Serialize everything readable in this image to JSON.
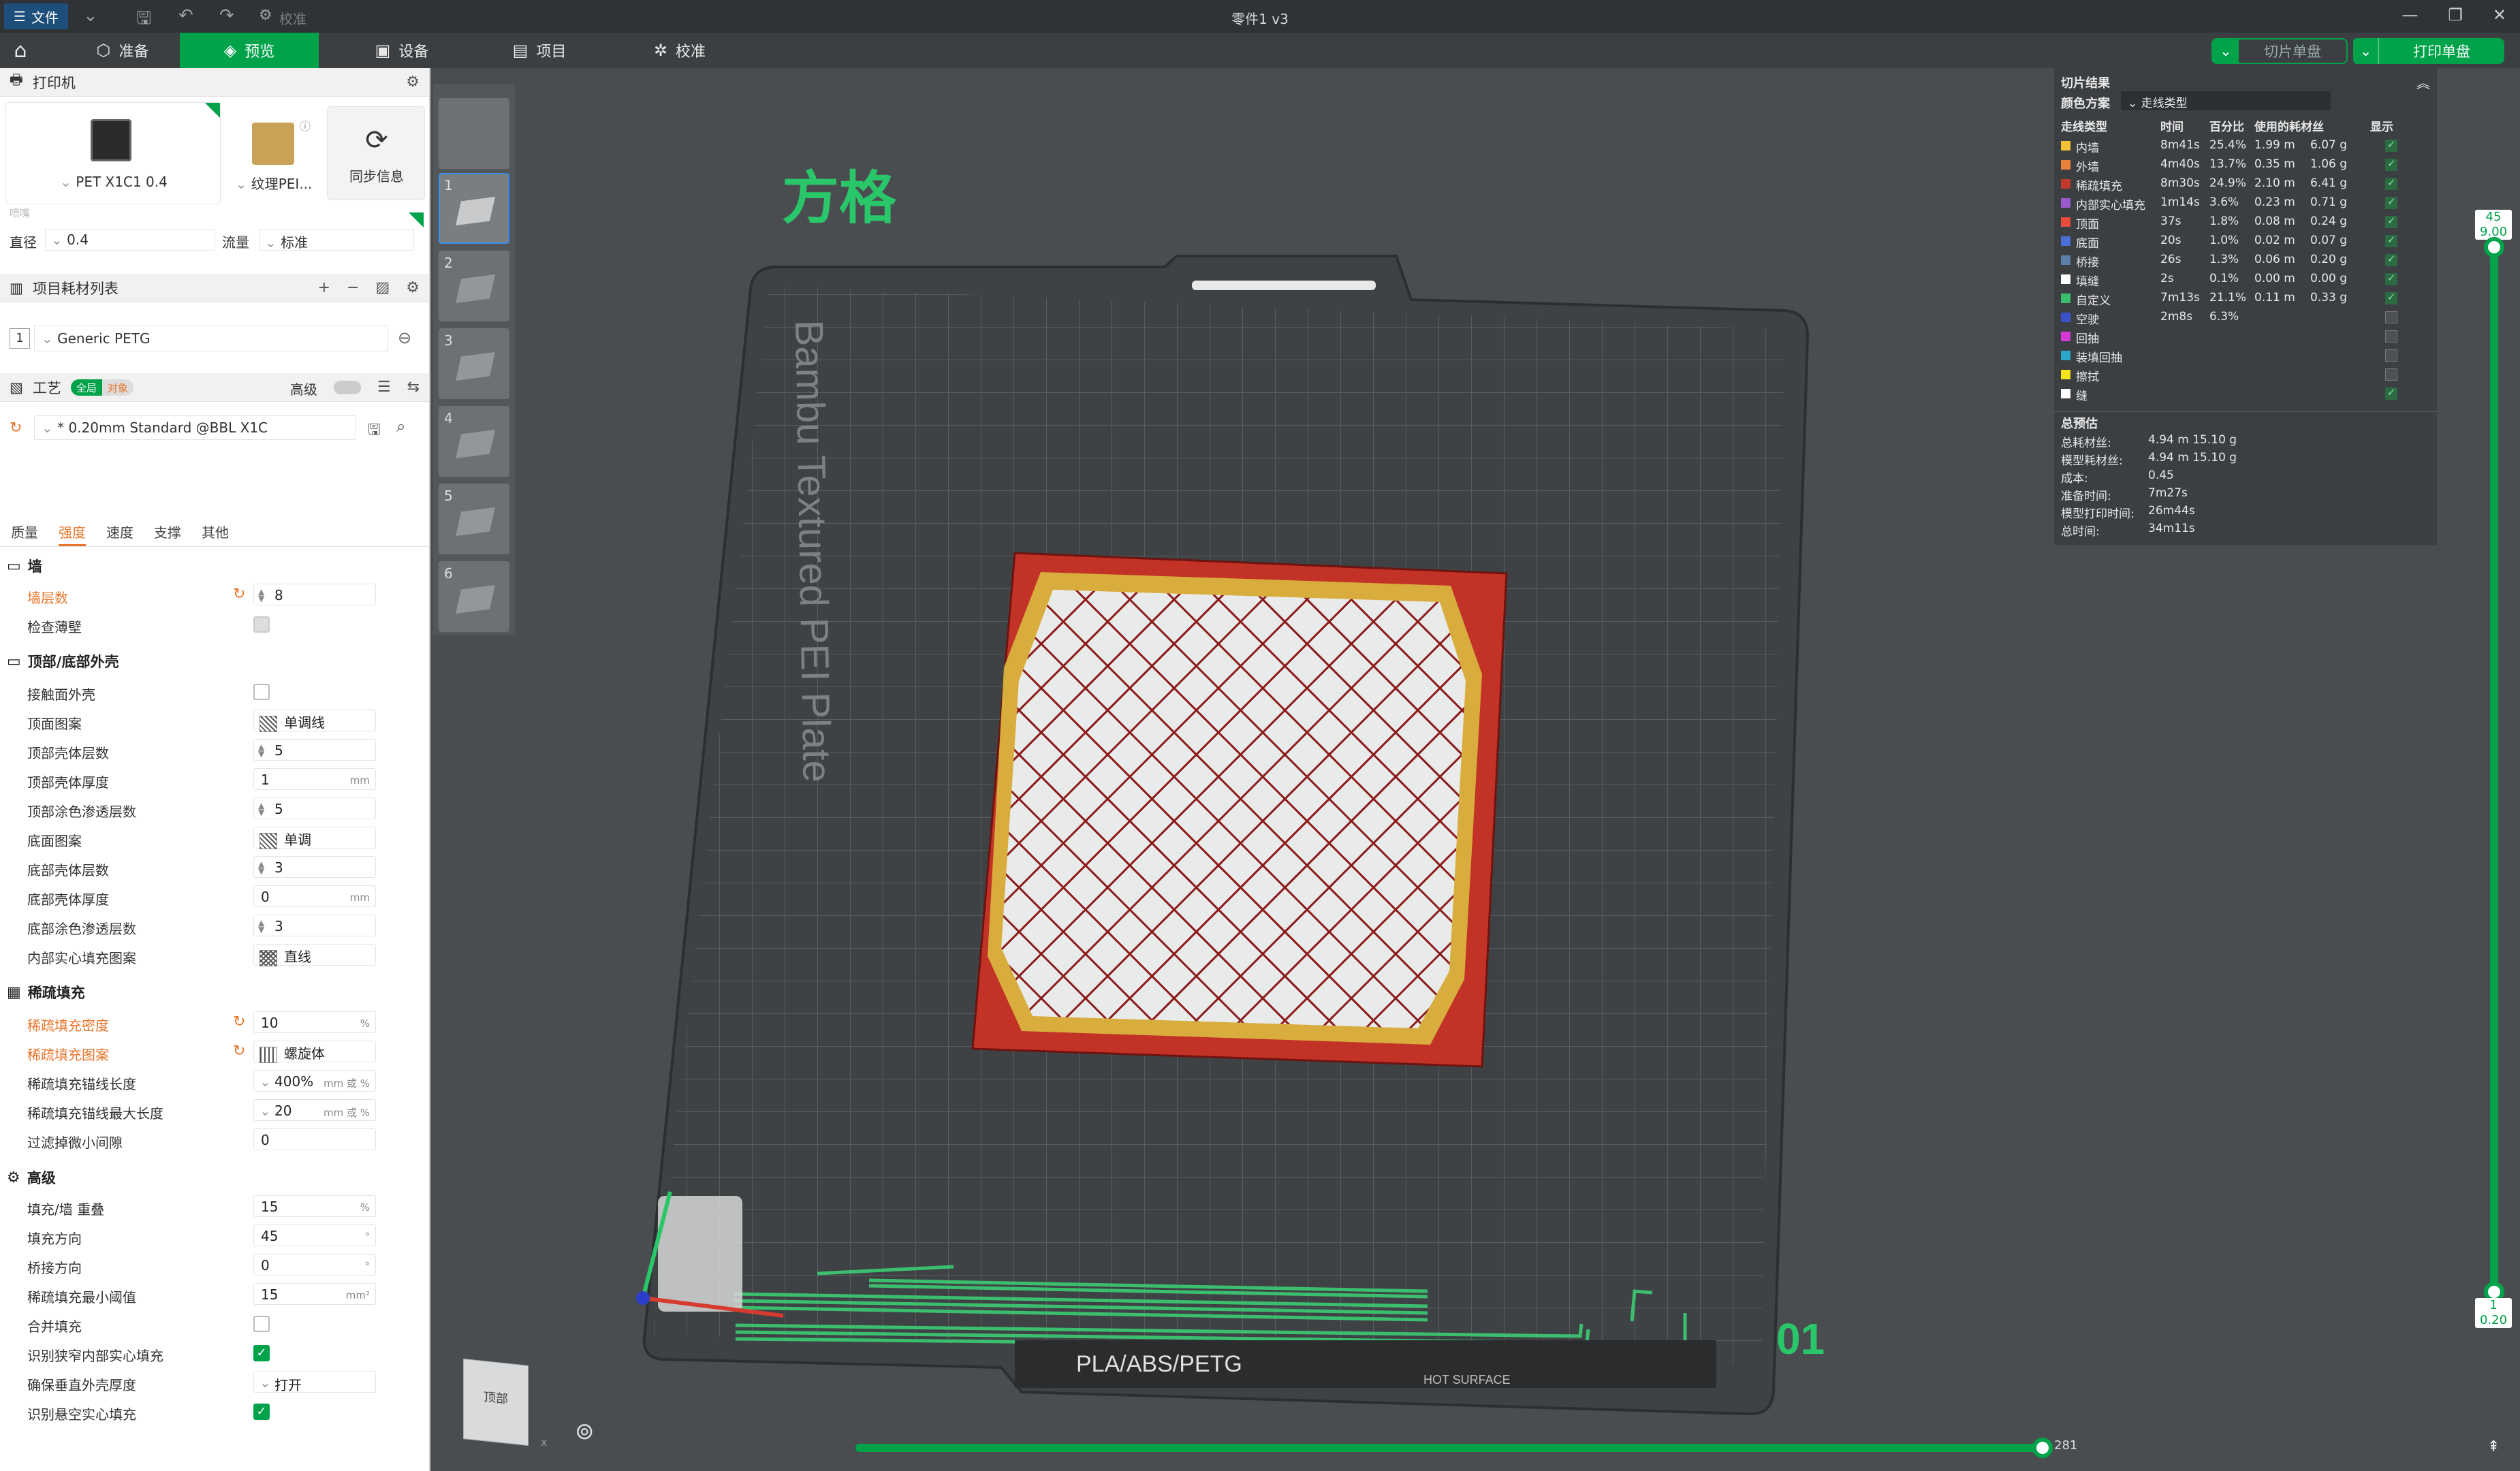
{
  "window": {
    "title": "零件1 v3",
    "file_menu": "文件",
    "calibrate_disabled": "校准"
  },
  "tabs": [
    {
      "label": "准备"
    },
    {
      "label": "预览"
    },
    {
      "label": "设备"
    },
    {
      "label": "项目"
    },
    {
      "label": "校准"
    }
  ],
  "actions": {
    "slice": "切片单盘",
    "print": "打印单盘"
  },
  "printer": {
    "section_title": "打印机",
    "model": "PET X1C1 0.4",
    "plate": "纹理PEI...",
    "sync": "同步信息",
    "nozzle_group_label": "喷嘴",
    "diameter_label": "直径",
    "diameter_value": "0.4",
    "flow_label": "流量",
    "flow_value": "标准"
  },
  "filaments": {
    "section_title": "项目耗材列表",
    "items": [
      {
        "index": "1",
        "name": "Generic PETG"
      }
    ]
  },
  "process": {
    "section_title": "工艺",
    "toggle_global": "全局",
    "toggle_object": "对象",
    "advanced": "高级",
    "preset": "* 0.20mm Standard @BBL X1C",
    "subtabs": [
      "质量",
      "强度",
      "速度",
      "支撑",
      "其他"
    ],
    "active_subtab": "强度"
  },
  "settings": {
    "wall_group": "墙",
    "wall_loops": {
      "label": "墙层数",
      "value": "8"
    },
    "detect_thin": {
      "label": "检查薄壁"
    },
    "shell_group": "顶部/底部外壳",
    "interface_shells": {
      "label": "接触面外壳"
    },
    "top_pattern": {
      "label": "顶面图案",
      "value": "单调线"
    },
    "top_layers": {
      "label": "顶部壳体层数",
      "value": "5"
    },
    "top_thickness": {
      "label": "顶部壳体厚度",
      "value": "1",
      "unit": "mm"
    },
    "top_paint": {
      "label": "顶部涂色渗透层数",
      "value": "5"
    },
    "bottom_pattern": {
      "label": "底面图案",
      "value": "单调"
    },
    "bottom_layers": {
      "label": "底部壳体层数",
      "value": "3"
    },
    "bottom_thickness": {
      "label": "底部壳体厚度",
      "value": "0",
      "unit": "mm"
    },
    "bottom_paint": {
      "label": "底部涂色渗透层数",
      "value": "3"
    },
    "internal_solid": {
      "label": "内部实心填充图案",
      "value": "直线"
    },
    "infill_group": "稀疏填充",
    "infill_density": {
      "label": "稀疏填充密度",
      "value": "10",
      "unit": "%"
    },
    "infill_pattern": {
      "label": "稀疏填充图案",
      "value": "螺旋体"
    },
    "anchor_len": {
      "label": "稀疏填充锚线长度",
      "value": "400%",
      "unit": "mm 或 %"
    },
    "anchor_max": {
      "label": "稀疏填充锚线最大长度",
      "value": "20",
      "unit": "mm 或 %"
    },
    "filter_gap": {
      "label": "过滤掉微小间隙",
      "value": "0"
    },
    "advanced_group": "高级",
    "infill_overlap": {
      "label": "填充/墙 重叠",
      "value": "15",
      "unit": "%"
    },
    "infill_direction": {
      "label": "填充方向",
      "value": "45",
      "unit": "°"
    },
    "bridge_direction": {
      "label": "桥接方向",
      "value": "0",
      "unit": "°"
    },
    "min_infill_area": {
      "label": "稀疏填充最小阈值",
      "value": "15",
      "unit": "mm²"
    },
    "merge_infill": {
      "label": "合并填充"
    },
    "detect_narrow": {
      "label": "识别狭窄内部实心填充"
    },
    "ensure_vertical": {
      "label": "确保垂直外壳厚度",
      "value": "打开"
    },
    "detect_overhang": {
      "label": "识别悬空实心填充"
    }
  },
  "plates": [
    {
      "n": ""
    },
    {
      "n": "1"
    },
    {
      "n": "2"
    },
    {
      "n": "3"
    },
    {
      "n": "4"
    },
    {
      "n": "5"
    },
    {
      "n": "6"
    }
  ],
  "viewport": {
    "overlay_title": "方格",
    "bed_name": "Bambu Textured PEI Plate",
    "bed_label": "PLA/ABS/PETG",
    "hot_surface": "HOT SURFACE",
    "plate_number": "01",
    "view_cube": "顶部"
  },
  "results": {
    "title": "切片结果",
    "color_scheme_label": "颜色方案",
    "color_scheme_value": "走线类型",
    "columns": [
      "走线类型",
      "时间",
      "百分比",
      "使用的耗材丝",
      "显示"
    ],
    "rows": [
      {
        "name": "内墙",
        "color": "#f1c232",
        "time": "8m41s",
        "pct": "25.4%",
        "len": "1.99 m",
        "wt": "6.07 g",
        "shown": true
      },
      {
        "name": "外墙",
        "color": "#e8823a",
        "time": "4m40s",
        "pct": "13.7%",
        "len": "0.35 m",
        "wt": "1.06 g",
        "shown": true
      },
      {
        "name": "稀疏填充",
        "color": "#c0392b",
        "time": "8m30s",
        "pct": "24.9%",
        "len": "2.10 m",
        "wt": "6.41 g",
        "shown": true
      },
      {
        "name": "内部实心填充",
        "color": "#9b59d0",
        "time": "1m14s",
        "pct": "3.6%",
        "len": "0.23 m",
        "wt": "0.71 g",
        "shown": true
      },
      {
        "name": "顶面",
        "color": "#e74c3c",
        "time": "37s",
        "pct": "1.8%",
        "len": "0.08 m",
        "wt": "0.24 g",
        "shown": true
      },
      {
        "name": "底面",
        "color": "#4a6fd8",
        "time": "20s",
        "pct": "1.0%",
        "len": "0.02 m",
        "wt": "0.07 g",
        "shown": true
      },
      {
        "name": "桥接",
        "color": "#5b7fa8",
        "time": "26s",
        "pct": "1.3%",
        "len": "0.06 m",
        "wt": "0.20 g",
        "shown": true
      },
      {
        "name": "填缝",
        "color": "#ffffff",
        "time": "2s",
        "pct": "0.1%",
        "len": "0.00 m",
        "wt": "0.00 g",
        "shown": true
      },
      {
        "name": "自定义",
        "color": "#3bbf6e",
        "time": "7m13s",
        "pct": "21.1%",
        "len": "0.11 m",
        "wt": "0.33 g",
        "shown": true
      },
      {
        "name": "空驶",
        "color": "#3a52c9",
        "time": "2m8s",
        "pct": "6.3%",
        "len": "",
        "wt": "",
        "shown": false
      },
      {
        "name": "回抽",
        "color": "#d63ad6",
        "time": "",
        "pct": "",
        "len": "",
        "wt": "",
        "shown": false
      },
      {
        "name": "装填回抽",
        "color": "#2aa7c9",
        "time": "",
        "pct": "",
        "len": "",
        "wt": "",
        "shown": false
      },
      {
        "name": "擦拭",
        "color": "#f4e41a",
        "time": "",
        "pct": "",
        "len": "",
        "wt": "",
        "shown": false
      },
      {
        "name": "缝",
        "color": "#ffffff",
        "time": "",
        "pct": "",
        "len": "",
        "wt": "",
        "shown": true
      }
    ],
    "estimate_title": "总预估",
    "estimates": [
      {
        "k": "总耗材丝:",
        "v": "4.94 m    15.10 g"
      },
      {
        "k": "模型耗材丝:",
        "v": "4.94 m    15.10 g"
      },
      {
        "k": "成本:",
        "v": "0.45"
      },
      {
        "k": "准备时间:",
        "v": "7m27s"
      },
      {
        "k": "模型打印时间:",
        "v": "26m44s"
      },
      {
        "k": "总时间:",
        "v": "34m11s"
      }
    ]
  },
  "layer_slider": {
    "top_layer": "45",
    "top_height": "9.00",
    "bottom_layer": "1",
    "bottom_height": "0.20",
    "range_fraction": 1.0
  },
  "move_slider": {
    "value": "281",
    "fraction": 1.0
  },
  "colors": {
    "accent": "#00a24a",
    "modified": "#e8752a",
    "bed": "#3f4245"
  }
}
